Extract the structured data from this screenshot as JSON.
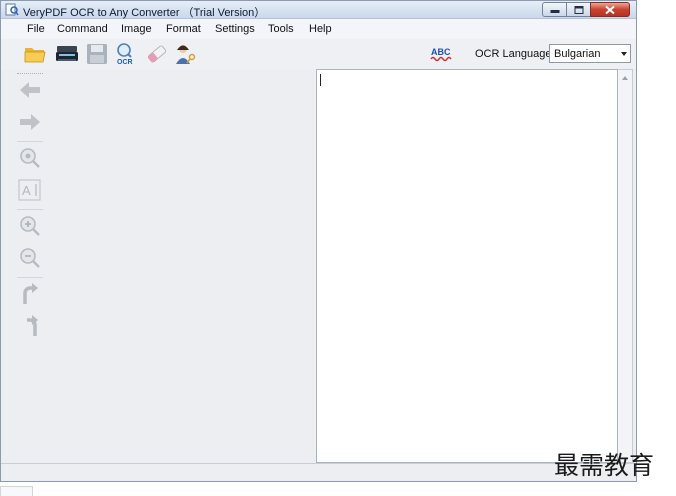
{
  "window": {
    "title": "VeryPDF OCR to Any Converter （Trial Version）",
    "title_icon": "app-icon",
    "controls": {
      "minimize_icon": "minimize-icon",
      "maximize_icon": "maximize-icon",
      "close_icon": "close-icon"
    }
  },
  "menu": {
    "items": [
      {
        "label": "File"
      },
      {
        "label": "Command"
      },
      {
        "label": "Image"
      },
      {
        "label": "Format"
      },
      {
        "label": "Settings"
      },
      {
        "label": "Tools"
      },
      {
        "label": "Help"
      }
    ]
  },
  "toolbar": {
    "buttons": [
      {
        "icon": "open-folder-icon"
      },
      {
        "icon": "scanner-icon"
      },
      {
        "icon": "save-icon"
      },
      {
        "icon": "ocr-icon"
      },
      {
        "icon": "eraser-icon"
      },
      {
        "icon": "user-key-icon"
      }
    ],
    "spellcheck_icon": "spellcheck-icon",
    "spellcheck_glyph": "ABC",
    "ocr_glyph": "OCR",
    "ocr_language_label": "OCR Language",
    "ocr_language_value": "Bulgarian"
  },
  "side_tools": [
    {
      "icon": "arrow-left-icon"
    },
    {
      "icon": "arrow-right-icon"
    },
    {
      "icon": "zoom-area-icon"
    },
    {
      "icon": "text-select-icon"
    },
    {
      "icon": "zoom-in-icon"
    },
    {
      "icon": "zoom-out-icon"
    },
    {
      "icon": "rotate-left-icon"
    },
    {
      "icon": "rotate-right-icon"
    }
  ],
  "text_pane": {
    "content": ""
  },
  "colors": {
    "titlebar_top": "#e7eef7",
    "titlebar_bottom": "#c9d8ea",
    "close_button": "#c8432f",
    "panel_bg": "#eceef1"
  },
  "watermark": {
    "text": "最需教育"
  }
}
